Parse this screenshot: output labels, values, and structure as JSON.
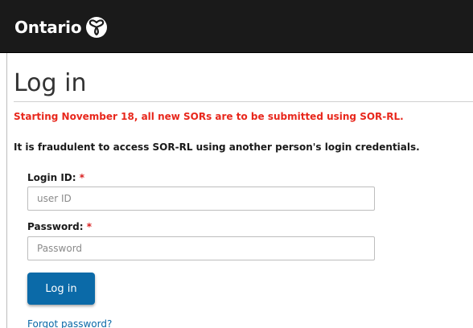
{
  "header": {
    "brand_text": "Ontario",
    "logo_icon": "trillium-logo-icon",
    "background_color": "#1a1a1a"
  },
  "page": {
    "title": "Log in",
    "notice": "Starting November 18, all new SORs are to be submitted using SOR-RL.",
    "notice_color": "#e8271c",
    "warning": "It is fraudulent to access SOR-RL using another person's login credentials."
  },
  "form": {
    "login_id": {
      "label": "Login ID:",
      "required_marker": "*",
      "value": "",
      "placeholder": "user ID"
    },
    "password": {
      "label": "Password:",
      "required_marker": "*",
      "value": "",
      "placeholder": "Password"
    },
    "submit_label": "Log in",
    "submit_color": "#0b6aa8",
    "forgot_password_label": "Forgot password?"
  }
}
